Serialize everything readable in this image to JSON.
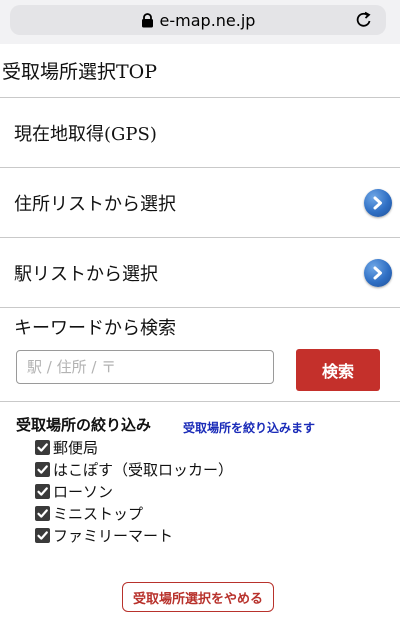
{
  "browser": {
    "url": "e-map.ne.jp"
  },
  "page": {
    "title": "受取場所選択TOP"
  },
  "menu": {
    "gps": "現在地取得(GPS)",
    "address_list": "住所リストから選択",
    "station_list": "駅リストから選択"
  },
  "keyword": {
    "label": "キーワードから検索",
    "placeholder": "駅 / 住所 / 〒",
    "value": "",
    "button": "検索"
  },
  "filter": {
    "title": "受取場所の絞り込み",
    "hint": "受取場所を絞り込みます",
    "options": [
      {
        "label": "郵便局",
        "checked": true
      },
      {
        "label": "はこぽす（受取ロッカー）",
        "checked": true
      },
      {
        "label": "ローソン",
        "checked": true
      },
      {
        "label": "ミニストップ",
        "checked": true
      },
      {
        "label": "ファミリーマート",
        "checked": true
      }
    ]
  },
  "cancel_button": "受取場所選択をやめる",
  "icons": {
    "lock": "lock-icon",
    "reload": "reload-icon",
    "arrow": "chevron-right-icon",
    "check": "checkmark-icon"
  },
  "colors": {
    "search_button": "#c4302b",
    "arrow_button": "#2f6fc4",
    "hint_text": "#1a2bb8",
    "cancel_border": "#b8322c"
  }
}
